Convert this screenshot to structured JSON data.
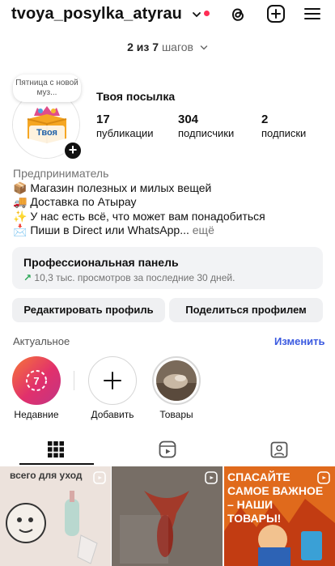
{
  "header": {
    "username": "tvoya_posylka_atyrau",
    "steps_prefix": "2 из 7",
    "steps_suffix": "шагов"
  },
  "profile": {
    "note": "Пятница с новой муз...",
    "avatar_text": "Твоя Посыл",
    "name": "Твоя посылка",
    "stats": [
      {
        "value": "17",
        "label": "публикации"
      },
      {
        "value": "304",
        "label": "подписчики"
      },
      {
        "value": "2",
        "label": "подписки"
      }
    ]
  },
  "bio": {
    "category": "Предприниматель",
    "lines": [
      "📦 Магазин полезных и милых вещей",
      "🚚 Доставка по Атырау",
      "✨ У нас есть всё, что может вам понадобиться",
      "📩 Пиши в Direct или WhatsApp..."
    ],
    "more": "ещё"
  },
  "pro_panel": {
    "title": "Профессиональная панель",
    "subtitle": "10,3 тыс. просмотров за последние 30 дней."
  },
  "buttons": {
    "edit": "Редактировать профиль",
    "share": "Поделиться профилем"
  },
  "highlights": {
    "title": "Актуальное",
    "change": "Изменить",
    "items": [
      {
        "label": "Недавние"
      },
      {
        "label": "Добавить"
      },
      {
        "label": "Товары"
      }
    ]
  },
  "grid": {
    "post1_text": "всего для уход",
    "post3_text": "спасайте самое важное – наши товары!"
  },
  "colors": {
    "accent_blue": "#3b5ae0",
    "notification_red": "#ff2d55",
    "growth_green": "#2aa755"
  }
}
